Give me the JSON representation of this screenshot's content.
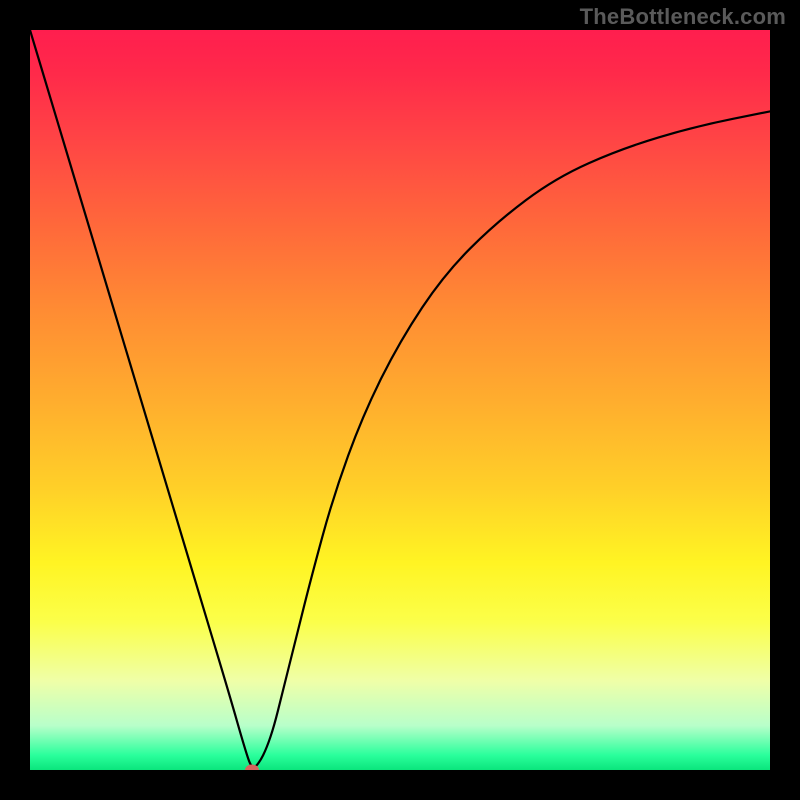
{
  "watermark": "TheBottleneck.com",
  "chart_data": {
    "type": "line",
    "title": "",
    "xlabel": "",
    "ylabel": "",
    "xlim": [
      0,
      100
    ],
    "ylim": [
      0,
      100
    ],
    "grid": false,
    "series": [
      {
        "name": "curve",
        "x": [
          0,
          3,
          6,
          9,
          12,
          15,
          18,
          21,
          24,
          27,
          29,
          30,
          31,
          32,
          33,
          34,
          36,
          38,
          41,
          45,
          50,
          56,
          63,
          71,
          80,
          90,
          100
        ],
        "y": [
          100,
          90,
          80,
          70,
          60,
          50,
          40,
          30,
          20,
          10,
          3,
          0,
          1,
          3,
          6,
          10,
          18,
          26,
          37,
          48,
          58,
          67,
          74,
          80,
          84,
          87,
          89
        ]
      }
    ],
    "marker": {
      "x": 30,
      "y": 0,
      "color": "#d6645d"
    },
    "background_gradient": {
      "stops": [
        {
          "pos": 0,
          "color": "#ff1e4e"
        },
        {
          "pos": 15,
          "color": "#ff4545"
        },
        {
          "pos": 38,
          "color": "#ff8c33"
        },
        {
          "pos": 62,
          "color": "#ffd028"
        },
        {
          "pos": 80,
          "color": "#fbff4a"
        },
        {
          "pos": 94,
          "color": "#b8ffca"
        },
        {
          "pos": 100,
          "color": "#0be57c"
        }
      ]
    }
  }
}
